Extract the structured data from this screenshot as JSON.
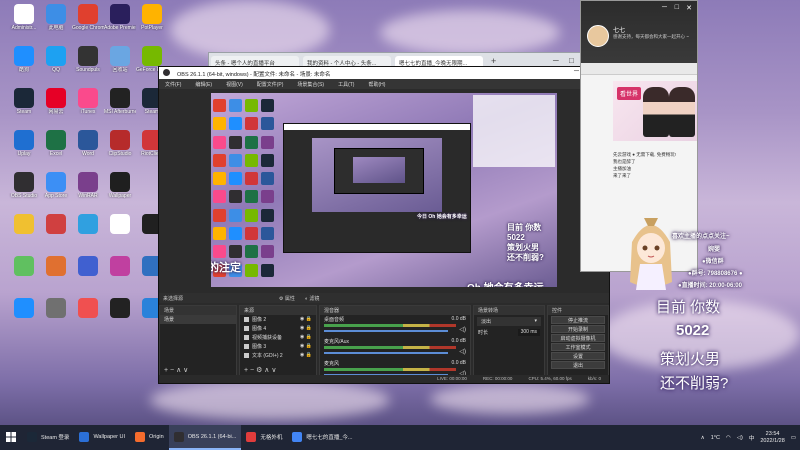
{
  "taskbar": {
    "items": [
      {
        "label": "Steam 登录",
        "color": "#1b2838"
      },
      {
        "label": "Wallpaper UI",
        "color": "#2b6fd6"
      },
      {
        "label": "Origin",
        "color": "#f56c2d"
      },
      {
        "label": "OBS 26.1.1 (64-bi...",
        "color": "#302e31"
      },
      {
        "label": "无格外机",
        "color": "#e03c3c"
      },
      {
        "label": "嗯七七的直播_今...",
        "color": "#4285f4"
      }
    ],
    "tray_temp": "1°C",
    "time": "23:54",
    "date": "2022/1/28"
  },
  "browser": {
    "tabs": [
      "头条 - 嗯个人的直播平台",
      "我的资料 - 个人中心 - 头条...",
      "嗯七七的直播_今晚无限期..."
    ],
    "add": "+",
    "min": "─",
    "max": "□",
    "close": "✕"
  },
  "obs": {
    "title": "OBS 26.1.1 (64-bit, windows) - 配置文件: 未命名 - 场景: 未命名",
    "menu": [
      "文件(F)",
      "编辑(E)",
      "视图(V)",
      "配置文件(P)",
      "场景集合(S)",
      "工具(T)",
      "帮助(H)"
    ],
    "dock_header_left": "来选择源",
    "props_label": "属性",
    "filters_label": "滤镜",
    "scenes": {
      "title": "场景",
      "items": [
        "场景"
      ]
    },
    "sources": {
      "title": "来源",
      "items": [
        "图像 2",
        "图像 4",
        "视频捕获设备",
        "图像 3",
        "文本 (GDI+) 2"
      ]
    },
    "mixer": {
      "title": "混音器",
      "channels": [
        {
          "name": "桌面音频",
          "db": "0.0 dB"
        },
        {
          "name": "麦克风/Aux",
          "db": "0.0 dB"
        },
        {
          "name": "麦克风",
          "db": "0.0 dB"
        }
      ]
    },
    "transitions": {
      "title": "场景转场",
      "type": "淡出",
      "duration_label": "时长",
      "duration": "300 ms"
    },
    "controls": {
      "title": "控件",
      "buttons": [
        "停止推流",
        "开始录制",
        "启动虚拟摄像机",
        "工作室模式",
        "设置",
        "退出"
      ]
    },
    "status": {
      "live": "LIVE: 00:00:00",
      "rec": "REC: 00:00:00",
      "cpu": "CPU: 5.4%, 60.00 fps",
      "kbps": "kb/s: 0"
    },
    "preview": {
      "caption_left": "遇见你的注定",
      "caption_right": "Oh 她会有多幸运",
      "small_caption": "今日 Oh 她会有多幸运",
      "overlay_lines": [
        "目前 你数",
        "5022",
        "策划火男",
        "还不削弱?"
      ]
    }
  },
  "chat": {
    "top_name": "七七",
    "desc": "感谢支持，每天都会和大家一起开心 ~",
    "badge": "看世界",
    "messages": [
      "先云游戏 ● 无需下载, 免费畅玩!",
      "我也是醉了",
      "主播加油",
      "来了来了"
    ],
    "controls": [
      "─",
      "□",
      "✕"
    ]
  },
  "overlay": {
    "welcome": "喜欢主播的点点关注~",
    "host": "婉婴",
    "group": "●微信群",
    "qq": "●群号: 798808676 ●",
    "live_time": "●直播时间: 20:00-06:00",
    "big_lines": [
      "目前 你数",
      "5022",
      "策划火男",
      "还不削弱?"
    ],
    "left_caption": "遇见你的注定",
    "right_caption": "Oh 她会有多幸运"
  },
  "desktop_icons": [
    {
      "label": "Administr...",
      "color": "#ffffff"
    },
    {
      "label": "此电脑",
      "color": "#3d8ee6"
    },
    {
      "label": "Google Chrome",
      "color": "#e0402e"
    },
    {
      "label": "Adobe Premiere",
      "color": "#2a1f5c"
    },
    {
      "label": "PotPlayer",
      "color": "#ffb300"
    },
    {
      "label": "酷狗",
      "color": "#1f8fff"
    },
    {
      "label": "QQ",
      "color": "#1da1f2"
    },
    {
      "label": "Soundpuls",
      "color": "#333333"
    },
    {
      "label": "回收站",
      "color": "#6aa6e2"
    },
    {
      "label": "GeForce Experience",
      "color": "#76b900"
    },
    {
      "label": "Steam",
      "color": "#1b2838"
    },
    {
      "label": "网易云",
      "color": "#e60026"
    },
    {
      "label": "iTunes",
      "color": "#fa4a8c"
    },
    {
      "label": "MSI Afterburner",
      "color": "#222222"
    },
    {
      "label": "Steam",
      "color": "#1b2838"
    },
    {
      "label": "Uplay",
      "color": "#1f6fd1"
    },
    {
      "label": "Excel",
      "color": "#1e7145"
    },
    {
      "label": "Word",
      "color": "#2b579a"
    },
    {
      "label": "ClipStudio",
      "color": "#b62b2b"
    },
    {
      "label": "RiotClient",
      "color": "#d13639"
    },
    {
      "label": "OBS Studio",
      "color": "#302e31"
    },
    {
      "label": "App Store",
      "color": "#3c8ff5"
    },
    {
      "label": "WinRAR",
      "color": "#7a3f8c"
    },
    {
      "label": "Wallpaper",
      "color": "#1f1f1f"
    }
  ]
}
